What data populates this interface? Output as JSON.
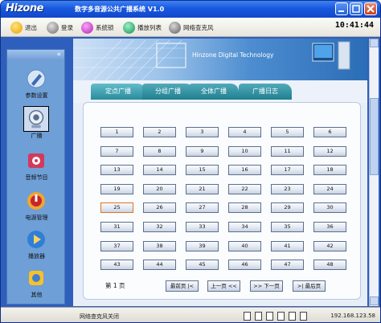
{
  "window": {
    "brand": "Hizone",
    "title": "数字多音源公共广播系统 V1.0",
    "accent": "#2f5fbd"
  },
  "toolbar": {
    "items": [
      {
        "label": "退出",
        "icon": "exit-icon",
        "color": "#f0b400"
      },
      {
        "label": "登录",
        "icon": "login-icon",
        "color": "#8c8c8c"
      },
      {
        "label": "系统锁",
        "icon": "lock-icon",
        "color": "#c83cc8"
      },
      {
        "label": "播放列表",
        "icon": "playlist-icon",
        "color": "#1aa060"
      },
      {
        "label": "网络查克风",
        "icon": "microphone-icon",
        "color": "#707070"
      }
    ],
    "clock": "10:41:44"
  },
  "sidebar": {
    "collapse_glyph": "«",
    "items": [
      {
        "label": "参数设置",
        "icon": "settings-icon"
      },
      {
        "label": "广播",
        "icon": "broadcast-icon"
      },
      {
        "label": "音频节目",
        "icon": "audio-library-icon"
      },
      {
        "label": "电源管理",
        "icon": "power-icon"
      },
      {
        "label": "播放器",
        "icon": "player-icon"
      },
      {
        "label": "其他",
        "icon": "other-icon"
      }
    ]
  },
  "banner": {
    "text": "Hinzone Digital Technology"
  },
  "tabs": [
    "定点广播",
    "分组广播",
    "全体广播",
    "广播日志"
  ],
  "grid": {
    "buttons": [
      "1",
      "2",
      "3",
      "4",
      "5",
      "6",
      "7",
      "8",
      "9",
      "10",
      "11",
      "12",
      "13",
      "14",
      "15",
      "16",
      "17",
      "18",
      "19",
      "20",
      "21",
      "22",
      "23",
      "24",
      "25",
      "26",
      "27",
      "28",
      "29",
      "30",
      "31",
      "32",
      "33",
      "34",
      "35",
      "36",
      "37",
      "38",
      "39",
      "40",
      "41",
      "42",
      "43",
      "44",
      "45",
      "46",
      "47",
      "48"
    ],
    "selected": "25"
  },
  "pager": {
    "page_label": "第 1 页",
    "first": "最前页 |<",
    "prev": "上一页 <<",
    "next": ">> 下一页",
    "last": ">| 最后页"
  },
  "statusbar": {
    "text": "网络查克风关闭",
    "ip": "192.168.123.58"
  }
}
